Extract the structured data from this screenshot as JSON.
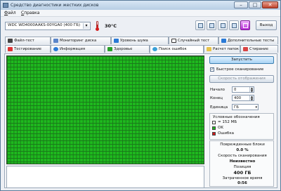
{
  "window": {
    "title": "Средство диагностики жестких дисков",
    "min": "–",
    "max": "□",
    "close": "✕"
  },
  "menu": [
    "Файл",
    "Справка"
  ],
  "toolbar": {
    "drive": "WDC WD4000AAKS-00YGA0  (400 ГБ)",
    "temperature": "30°C",
    "exit": "Выход",
    "icons": [
      "report-icon",
      "copy-icon",
      "save-icon",
      "wrench-icon",
      "purple-arrow-icon"
    ]
  },
  "tabs_row1": [
    "Файл-тест",
    "Мониторинг диска",
    "Уровень шума",
    "Случайный тест",
    "Дополнительные тесты"
  ],
  "tabs_row2": [
    "Тестирование",
    "Информация",
    "Здоровье",
    "Поиск ошибок",
    "Расчет папок",
    "Стирание"
  ],
  "active_tab": "Поиск ошибок",
  "scan": {
    "start_button": "Запустить",
    "fast_scan_label": "Быстрое сканирование",
    "fast_scan_checked": true,
    "speed_button": "Скорость отображения",
    "start_label": "Начало",
    "start_value": "0",
    "end_label": "Конец",
    "end_value": "400",
    "unit_label": "Единица",
    "unit_value": "ГБ"
  },
  "legend": {
    "title": "Условные обозначения",
    "items": [
      {
        "label": "= 152 МБ",
        "color": "#ffffff"
      },
      {
        "label": "OK",
        "color": "#1eb91e"
      },
      {
        "label": "Ошибка",
        "color": "#d21a1a"
      }
    ]
  },
  "stats": {
    "damaged_label": "Поврежденные блоки",
    "damaged_value": "0.0 %",
    "speed_label": "Скорость сканирования",
    "speed_value": "Неизвестно",
    "position_label": "Позиция",
    "position_value": "400 ГБ",
    "elapsed_label": "Затраченное время",
    "elapsed_value": "0:56"
  },
  "colors": {
    "ok": "#1eb91e",
    "error": "#d21a1a",
    "accent": "#3c7fb1"
  }
}
